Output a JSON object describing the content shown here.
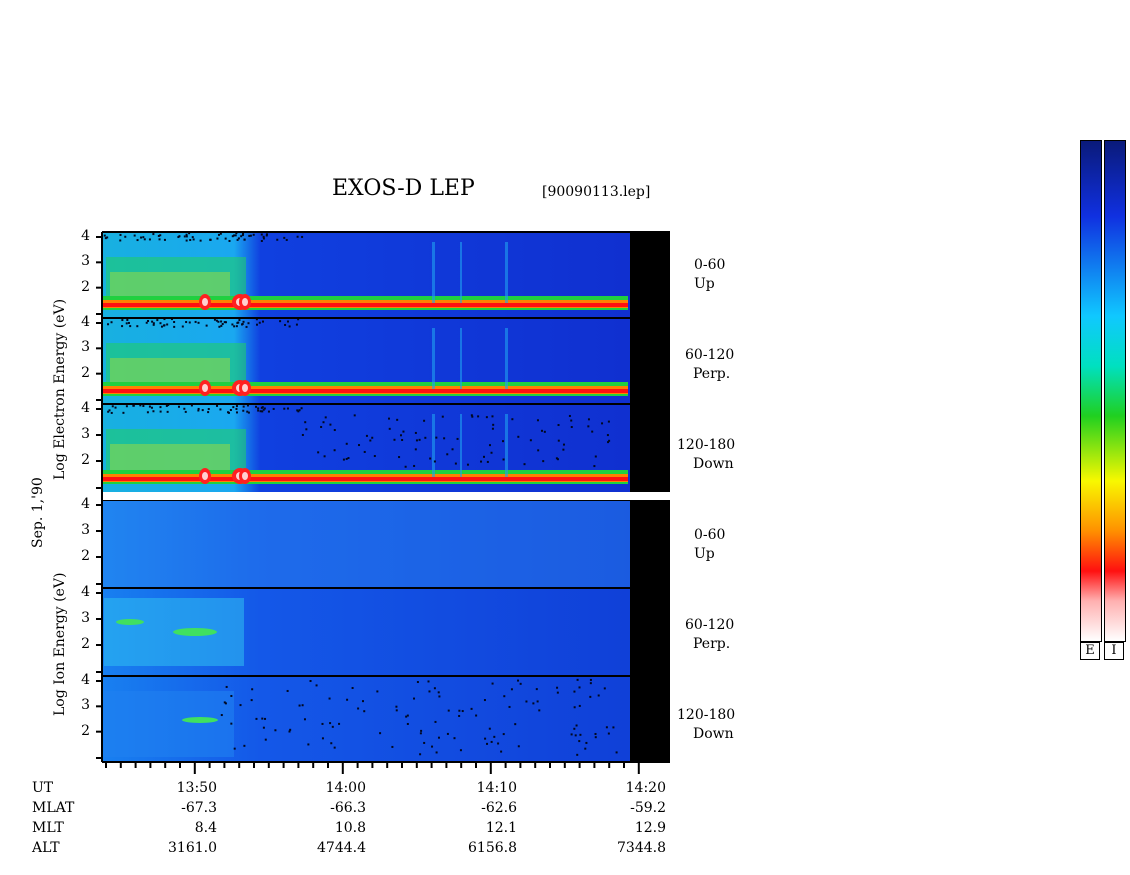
{
  "title": "EXOS-D LEP",
  "filename": "[90090113.lep]",
  "date_label": "Sep. 1,'90",
  "electron_axis_label": "Log Electron Energy (eV)",
  "ion_axis_label": "Log Ion Energy (eV)",
  "panels": [
    {
      "species": "electron",
      "pitch": "0-60",
      "dir": "Up"
    },
    {
      "species": "electron",
      "pitch": "60-120",
      "dir": "Perp."
    },
    {
      "species": "electron",
      "pitch": "120-180",
      "dir": "Down"
    },
    {
      "species": "ion",
      "pitch": "0-60",
      "dir": "Up"
    },
    {
      "species": "ion",
      "pitch": "60-120",
      "dir": "Perp."
    },
    {
      "species": "ion",
      "pitch": "120-180",
      "dir": "Down"
    }
  ],
  "y_ticks": [
    "4",
    "3",
    "2"
  ],
  "ephemeris": {
    "row_labels": [
      "UT",
      "MLAT",
      "MLT",
      "ALT"
    ],
    "columns": [
      {
        "UT": "13:50",
        "MLAT": "-67.3",
        "MLT": "8.4",
        "ALT": "3161.0"
      },
      {
        "UT": "14:00",
        "MLAT": "-66.3",
        "MLT": "10.8",
        "ALT": "4744.4"
      },
      {
        "UT": "14:10",
        "MLAT": "-62.6",
        "MLT": "12.1",
        "ALT": "6156.8"
      },
      {
        "UT": "14:20",
        "MLAT": "-59.2",
        "MLT": "12.9",
        "ALT": "7344.8"
      }
    ]
  },
  "colorbars": [
    {
      "label": "E"
    },
    {
      "label": "I"
    }
  ],
  "colors": {
    "background_spectrum": "#1030d0",
    "no_data": "#000000"
  },
  "chart_data": {
    "type": "heatmap",
    "title": "EXOS-D LEP",
    "xlabel": "UT",
    "ylabel": "Log Energy (eV)",
    "x_ticks": [
      "13:50",
      "14:00",
      "14:10",
      "14:20"
    ],
    "ylim": [
      1,
      4
    ],
    "y_ticks": [
      2,
      3,
      4
    ],
    "series": [
      {
        "name": "Electron 0-60 Up"
      },
      {
        "name": "Electron 60-120 Perp."
      },
      {
        "name": "Electron 120-180 Down"
      },
      {
        "name": "Ion 0-60 Up"
      },
      {
        "name": "Ion 60-120 Perp."
      },
      {
        "name": "Ion 120-180 Down"
      }
    ]
  }
}
